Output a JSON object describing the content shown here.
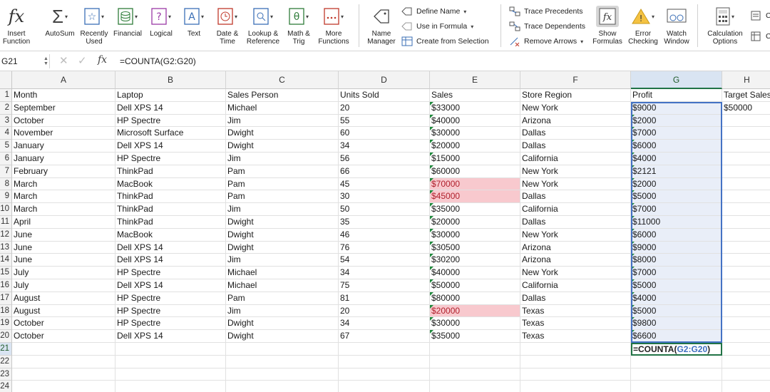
{
  "ribbon": {
    "insert_function": "Insert\nFunction",
    "autosum": "AutoSum",
    "recently_used": "Recently\nUsed",
    "financial": "Financial",
    "logical": "Logical",
    "text": "Text",
    "date_time": "Date &\nTime",
    "lookup_reference": "Lookup &\nReference",
    "math_trig": "Math &\nTrig",
    "more_functions": "More\nFunctions",
    "name_manager": "Name\nManager",
    "define_name": "Define Name",
    "use_in_formula": "Use in Formula",
    "create_from_selection": "Create from Selection",
    "trace_precedents": "Trace Precedents",
    "trace_dependents": "Trace Dependents",
    "remove_arrows": "Remove Arrows",
    "show_formulas": "Show\nFormulas",
    "error_checking": "Error\nChecking",
    "watch_window": "Watch\nWindow",
    "calculation_options": "Calculation\nOptions",
    "calc_now_cut": "C",
    "calc_sheet_cut": "C"
  },
  "formula_bar": {
    "name_box": "G21",
    "fx": "fx",
    "formula": "=COUNTA(G2:G20)"
  },
  "columns": [
    "A",
    "B",
    "C",
    "D",
    "E",
    "F",
    "G",
    "H"
  ],
  "row_numbers": [
    "1",
    "2",
    "3",
    "4",
    "5",
    "6",
    "7",
    "8",
    "9",
    "10",
    "11",
    "12",
    "13",
    "14",
    "15",
    "16",
    "17",
    "18",
    "19",
    "20",
    "21",
    "22",
    "23",
    "24"
  ],
  "headers": [
    "Month",
    "Laptop",
    "Sales Person",
    "Units Sold",
    "Sales",
    "Store Region",
    "Profit",
    "Target Sales"
  ],
  "rows": [
    [
      "September",
      "Dell XPS 14",
      "Michael",
      "20",
      "$33000",
      "New York",
      "$9000",
      "$50000"
    ],
    [
      "October",
      "HP Spectre",
      "Jim",
      "55",
      "$40000",
      "Arizona",
      "$2000",
      ""
    ],
    [
      "November",
      "Microsoft Surface",
      "Dwight",
      "60",
      "$30000",
      "Dallas",
      "$7000",
      ""
    ],
    [
      "January",
      "Dell XPS 14",
      "Dwight",
      "34",
      "$20000",
      "Dallas",
      "$6000",
      ""
    ],
    [
      "January",
      "HP Spectre",
      "Jim",
      "56",
      "$15000",
      "California",
      "$4000",
      ""
    ],
    [
      "February",
      "ThinkPad",
      "Pam",
      "66",
      "$60000",
      "New York",
      "$2121",
      ""
    ],
    [
      "March",
      "MacBook",
      "Pam",
      "45",
      "$70000",
      "New York",
      "$2000",
      ""
    ],
    [
      "March",
      "ThinkPad",
      "Pam",
      "30",
      "$45000",
      "Dallas",
      "$5000",
      ""
    ],
    [
      "March",
      "ThinkPad",
      "Jim",
      "50",
      "$35000",
      "California",
      "$7000",
      ""
    ],
    [
      "April",
      "ThinkPad",
      "Dwight",
      "35",
      "$20000",
      "Dallas",
      "$11000",
      ""
    ],
    [
      "June",
      "MacBook",
      "Dwight",
      "46",
      "$30000",
      "New York",
      "$6000",
      ""
    ],
    [
      "June",
      "Dell XPS 14",
      "Dwight",
      "76",
      "$30500",
      "Arizona",
      "$9000",
      ""
    ],
    [
      "June",
      "Dell XPS 14",
      "Jim",
      "54",
      "$30200",
      "Arizona",
      "$8000",
      ""
    ],
    [
      "July",
      "HP Spectre",
      "Michael",
      "34",
      "$40000",
      "New York",
      "$7000",
      ""
    ],
    [
      "July",
      "Dell XPS 14",
      "Michael",
      "75",
      "$50000",
      "California",
      "$5000",
      ""
    ],
    [
      "August",
      "HP Spectre",
      "Pam",
      "81",
      "$80000",
      "Dallas",
      "$4000",
      ""
    ],
    [
      "August",
      "HP Spectre",
      "Jim",
      "20",
      "$20000",
      "Texas",
      "$5000",
      ""
    ],
    [
      "October",
      "HP Spectre",
      "Dwight",
      "34",
      "$30000",
      "Texas",
      "$9800",
      ""
    ],
    [
      "October",
      "Dell XPS 14",
      "Dwight",
      "67",
      "$35000",
      "Texas",
      "$6600",
      ""
    ]
  ],
  "highlighted_sales_rows": [
    6,
    7,
    16
  ],
  "editing_cell": {
    "address": "G21",
    "formula_prefix": "=COUNTA(",
    "formula_ref": "G2:G20",
    "formula_suffix": ")"
  },
  "colors": {
    "accent_green": "#217346",
    "range_blue": "#4472c4",
    "highlight_fill": "#f8c9ce",
    "highlight_text": "#b0202c"
  }
}
